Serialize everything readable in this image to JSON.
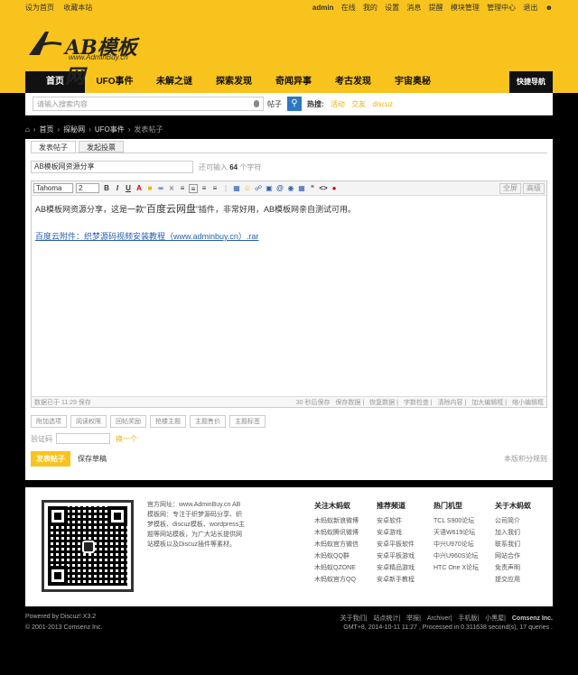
{
  "topbar": {
    "set_home": "设为首页",
    "bookmark": "收藏本站",
    "user": "admin",
    "online": "在线",
    "my": "我的",
    "settings": "设置",
    "messages": "消息",
    "remind": "提醒",
    "mod": "模块管理",
    "admin": "管理中心",
    "logout": "退出"
  },
  "logo": {
    "title": "AB模板网",
    "sub": "www.AdminBuy.cn"
  },
  "nav": {
    "items": [
      "首页",
      "UFO事件",
      "未解之谜",
      "探索发现",
      "奇闻异事",
      "考古发现",
      "宇宙奥秘"
    ],
    "quick": "快捷导航"
  },
  "search": {
    "placeholder": "请输入搜索内容",
    "type": "帖子",
    "hot_label": "热搜:",
    "hot": [
      "活动",
      "交友",
      "discuz"
    ]
  },
  "crumb": [
    "首页",
    "探秘网",
    "UFO事件",
    "发表帖子"
  ],
  "tabs": [
    "发表帖子",
    "发起投票"
  ],
  "subject": {
    "value": "AB模板网资源分享",
    "tip_pre": "还可输入",
    "tip_num": "64",
    "tip_suf": "个字符"
  },
  "editor": {
    "font": "Tahoma",
    "size": "2",
    "full": "全屏",
    "advanced": "高级",
    "body1": "AB模板网资源分享，这是一款“",
    "body_big": "百度云网盘",
    "body2": "”插件，非常好用，AB模板网亲自测试可用。",
    "link": "百度云附件：织梦源码视频安装教程（www.adminbuy.cn）.rar",
    "saved": "数据已于 11:29 保存",
    "autosave": "30 秒后保存",
    "save": "保存数据",
    "restore": "恢复数据",
    "check": "字数检查",
    "clear": "清除内容",
    "enlarge": "加大编辑框",
    "shrink": "缩小编辑框"
  },
  "options": [
    "附加选项",
    "阅读权限",
    "回帖奖励",
    "抢楼主题",
    "主题售价",
    "主题标签"
  ],
  "captcha": {
    "label": "验证码",
    "link": "换一个"
  },
  "buttons": {
    "post": "发表帖子",
    "draft": "保存草稿",
    "rules": "本版积分规则"
  },
  "footer": {
    "about": "官方网址：www.AdminBuy.cn AB模板网：专注于织梦源码分享、织梦模板、discuz模板、wordpress主题等网站模板，为广大站长提供网站模板以及Discuz插件等素材。",
    "cols": [
      {
        "title": "关注木蚂蚁",
        "items": [
          "木蚂蚁新浪微博",
          "木蚂蚁腾讯微博",
          "木蚂蚁官方微信",
          "木蚂蚁QQ群",
          "木蚂蚁QZONE",
          "木蚂蚁官方QQ"
        ]
      },
      {
        "title": "推荐频道",
        "items": [
          "安卓软件",
          "安卓游戏",
          "安卓平板软件",
          "安卓平板游戏",
          "安卓精品游戏",
          "安卓新手教程"
        ]
      },
      {
        "title": "热门机型",
        "items": [
          "TCL S900论坛",
          "天语W619论坛",
          "中兴U970论坛",
          "中兴U960S论坛",
          "HTC One X论坛"
        ]
      },
      {
        "title": "关于木蚂蚁",
        "items": [
          "公司简介",
          "加入我们",
          "联系我们",
          "网站合作",
          "免责声明",
          "提交应用"
        ]
      }
    ]
  },
  "bottom": {
    "powered": "Powered by Discuz! X3.2",
    "copy": "© 2001-2013 Comsenz Inc.",
    "links": [
      "关于我们",
      "站点统计",
      "举报",
      "Archiver",
      "手机版",
      "小黑屋"
    ],
    "company": "Comsenz Inc.",
    "gmt": "GMT+8, 2014-10-11 11:27 , Processed in 0.311638 second(s), 17 queries ."
  },
  "colors": {
    "brand": "#f8c31c",
    "dark": "#111111",
    "link": "#2a5db0"
  }
}
